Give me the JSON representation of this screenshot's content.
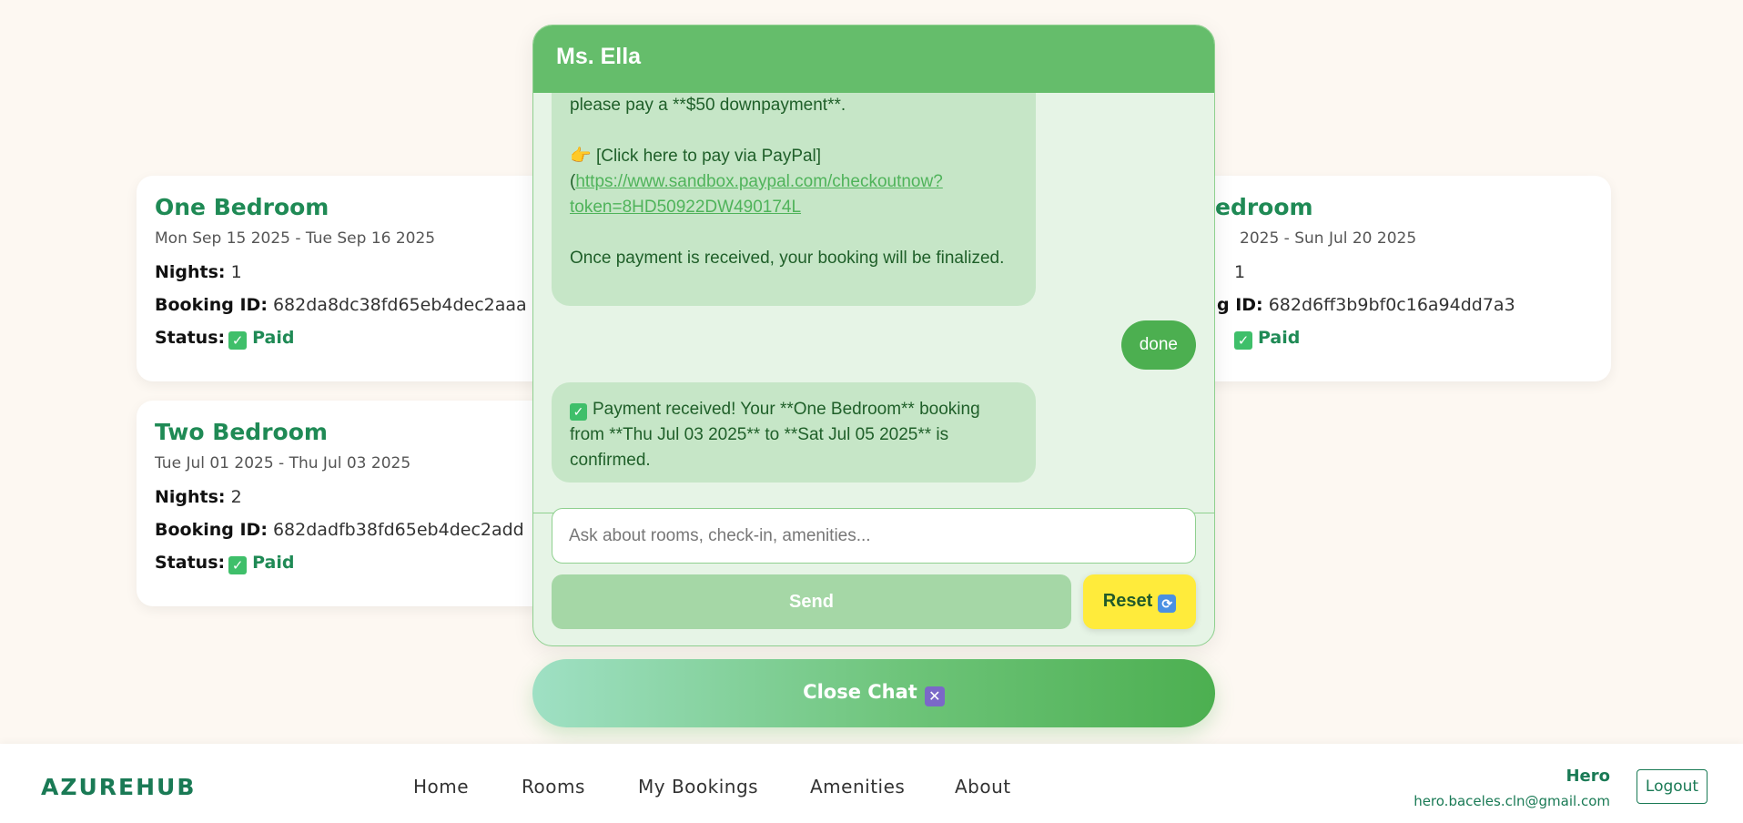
{
  "bookings": [
    {
      "title": "One Bedroom",
      "dates": "Mon Sep 15 2025 - Tue Sep 16 2025",
      "nights_label": "Nights:",
      "nights": "1",
      "id_label": "Booking ID:",
      "booking_id": "682da8dc38fd65eb4dec2aaa",
      "status_label": "Status:",
      "status": "Paid"
    },
    {
      "title": "Two Bedroom",
      "dates": "Tue Jul 01 2025 - Thu Jul 03 2025",
      "nights_label": "Nights:",
      "nights": "2",
      "id_label": "Booking ID:",
      "booking_id": "682dadfb38fd65eb4dec2add",
      "status_label": "Status:",
      "status": "Paid"
    },
    {
      "title": "edroom",
      "dates": "2025 - Sun Jul 20 2025",
      "nights": "1",
      "id_label": "g ID:",
      "booking_id": "682d6ff3b9bf0c16a94dd7a3",
      "status": "Paid"
    }
  ],
  "chat": {
    "title": "Ms. Ella",
    "messages": {
      "bot_1_line1": "please pay a **$50 downpayment**.",
      "bot_1_emoji": "👉",
      "bot_1_link_text": " [Click here to pay via PayPal]",
      "bot_1_link_open": "(",
      "bot_1_url": "https://www.sandbox.paypal.com/checkoutnow?token=8HD50922DW490174L",
      "bot_1_url_line1": "https://www.sandbox.paypal.com/checkoutnow?",
      "bot_1_url_line2": "token=8HD50922DW490174L",
      "bot_1_outro": "Once payment is received, your booking will be finalized.",
      "user_1": "done",
      "bot_2": "Payment received! Your **One Bedroom** booking from **Thu Jul 03 2025** to **Sat Jul 05 2025** is confirmed."
    },
    "input_placeholder": "Ask about rooms, check-in, amenities...",
    "input_value": "",
    "send_label": "Send",
    "reset_label": "Reset",
    "close_label": "Close Chat"
  },
  "icons": {
    "check": "check-icon",
    "point": "pointing-hand-icon",
    "reset": "refresh-icon",
    "close": "x-icon"
  },
  "navbar": {
    "brand": "AZUREHUB",
    "links": [
      "Home",
      "Rooms",
      "My Bookings",
      "Amenities",
      "About"
    ],
    "user_name": "Hero",
    "user_email": "hero.baceles.cln@gmail.com",
    "logout_label": "Logout"
  },
  "colors": {
    "accent_green": "#1f8a55",
    "chat_header": "#65bd6b",
    "bubble_bot": "#c6e6c7",
    "bubble_user": "#4caf50",
    "reset_yellow": "#ffeb3b",
    "background": "#fdf8f2"
  }
}
